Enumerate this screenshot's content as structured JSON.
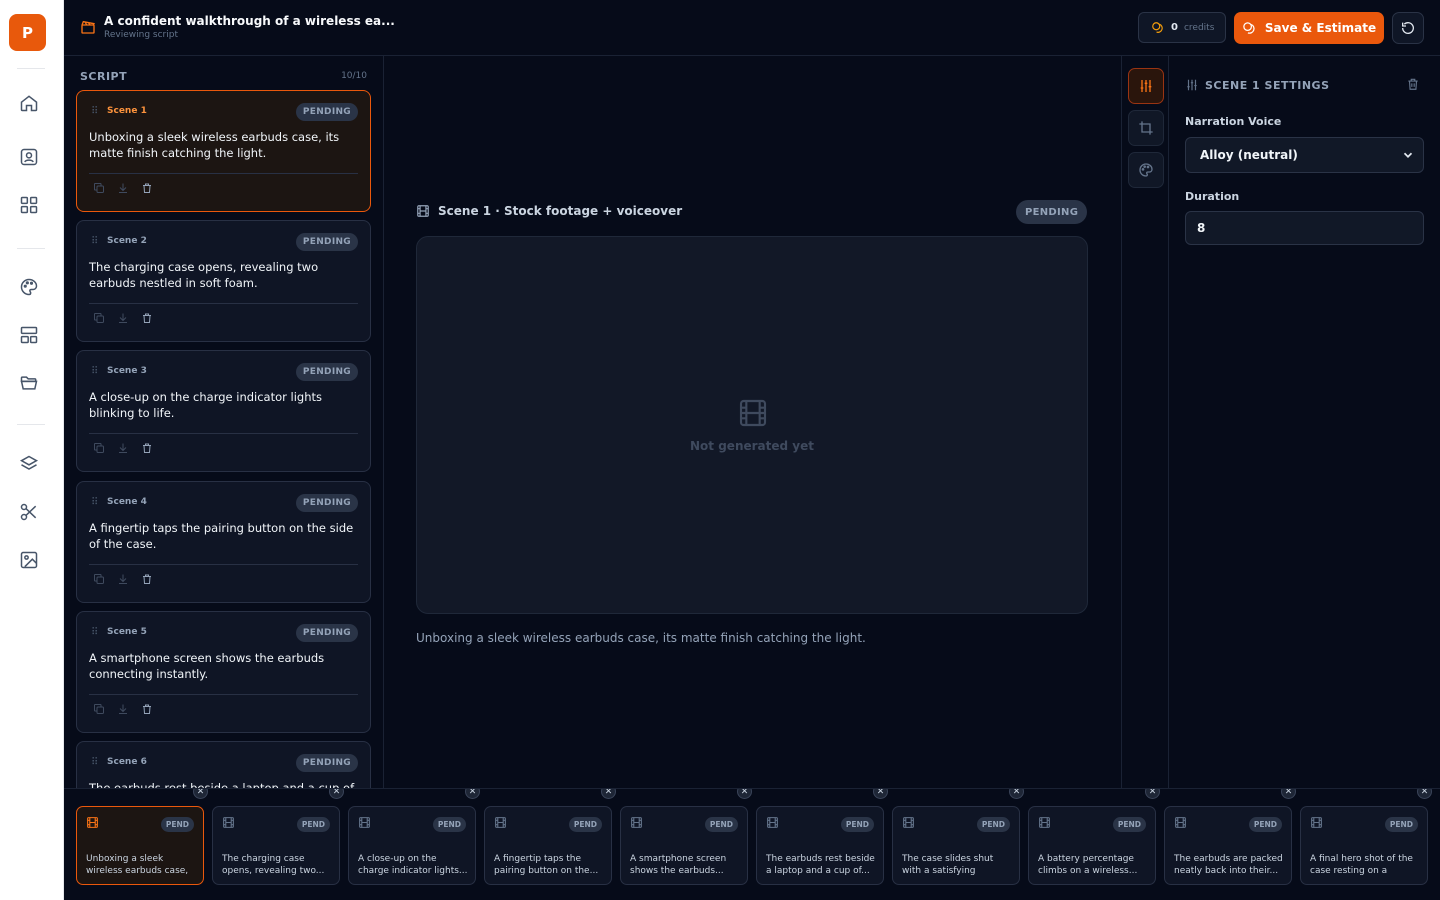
{
  "app": {
    "logo_letter": "P",
    "accent": "#ea580c"
  },
  "header": {
    "title": "A confident walkthrough of a wireless ea...",
    "subtitle": "Reviewing script",
    "credits_value": "0",
    "credits_label": "credits",
    "save_label": "Save & Estimate"
  },
  "script": {
    "heading": "SCRIPT",
    "count": "10/10",
    "scenes": [
      {
        "name": "Scene 1",
        "status": "PENDING",
        "text": "Unboxing a sleek wireless earbuds case, its matte finish catching the light."
      },
      {
        "name": "Scene 2",
        "status": "PENDING",
        "text": "The charging case opens, revealing two earbuds nestled in soft foam."
      },
      {
        "name": "Scene 3",
        "status": "PENDING",
        "text": "A close-up on the charge indicator lights blinking to life."
      },
      {
        "name": "Scene 4",
        "status": "PENDING",
        "text": "A fingertip taps the pairing button on the side of the case."
      },
      {
        "name": "Scene 5",
        "status": "PENDING",
        "text": "A smartphone screen shows the earbuds connecting instantly."
      },
      {
        "name": "Scene 6",
        "status": "PENDING",
        "text": "The earbuds rest beside a laptop and a cup of"
      }
    ]
  },
  "preview": {
    "heading": "Scene 1 · Stock footage + voiceover",
    "status": "PENDING",
    "placeholder": "Not generated yet",
    "caption": "Unboxing a sleek wireless earbuds case, its matte finish catching the light."
  },
  "settings": {
    "title": "SCENE 1 SETTINGS",
    "voice_label": "Narration Voice",
    "voice_value": "Alloy (neutral)",
    "duration_label": "Duration",
    "duration_value": "8"
  },
  "timeline": {
    "clips": [
      {
        "badge": "PEND",
        "text": "Unboxing a sleek wireless earbuds case, i..."
      },
      {
        "badge": "PEND",
        "text": "The charging case opens, revealing two..."
      },
      {
        "badge": "PEND",
        "text": "A close-up on the charge indicator lights..."
      },
      {
        "badge": "PEND",
        "text": "A fingertip taps the pairing button on the..."
      },
      {
        "badge": "PEND",
        "text": "A smartphone screen shows the earbuds..."
      },
      {
        "badge": "PEND",
        "text": "The earbuds rest beside a laptop and a cup of..."
      },
      {
        "badge": "PEND",
        "text": "The case slides shut with a satisfying magnetic..."
      },
      {
        "badge": "PEND",
        "text": "A battery percentage climbs on a wireless..."
      },
      {
        "badge": "PEND",
        "text": "The earbuds are packed neatly back into their..."
      },
      {
        "badge": "PEND",
        "text": "A final hero shot of the case resting on a clean..."
      }
    ]
  }
}
